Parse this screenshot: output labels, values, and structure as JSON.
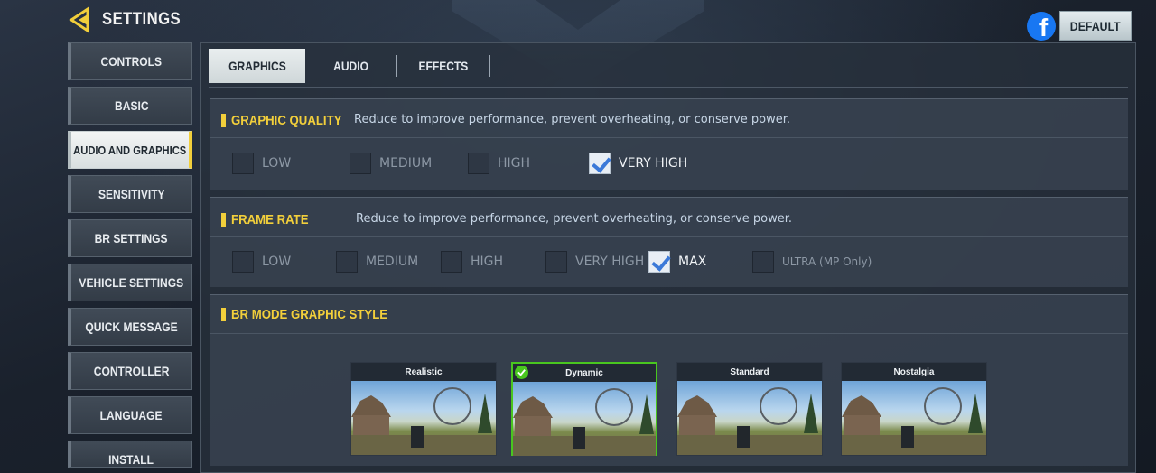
{
  "header": {
    "title": "SETTINGS",
    "default_label": "DEFAULT"
  },
  "sidebar": {
    "items": [
      {
        "label": "CONTROLS"
      },
      {
        "label": "BASIC"
      },
      {
        "label": "AUDIO AND GRAPHICS",
        "active": true
      },
      {
        "label": "SENSITIVITY"
      },
      {
        "label": "BR SETTINGS"
      },
      {
        "label": "VEHICLE SETTINGS"
      },
      {
        "label": "QUICK MESSAGE"
      },
      {
        "label": "CONTROLLER"
      },
      {
        "label": "LANGUAGE"
      },
      {
        "label": "INSTALL"
      }
    ]
  },
  "tabs": [
    {
      "label": "GRAPHICS",
      "active": true
    },
    {
      "label": "AUDIO"
    },
    {
      "label": "EFFECTS"
    }
  ],
  "graphic_quality": {
    "title": "GRAPHIC QUALITY",
    "description": "Reduce to improve performance, prevent overheating, or conserve power.",
    "options": [
      "LOW",
      "MEDIUM",
      "HIGH",
      "VERY HIGH"
    ],
    "selected": "VERY HIGH"
  },
  "frame_rate": {
    "title": "FRAME RATE",
    "description": "Reduce to improve performance, prevent overheating, or conserve power.",
    "options": [
      "LOW",
      "MEDIUM",
      "HIGH",
      "VERY HIGH",
      "MAX",
      "ULTRA (MP Only)"
    ],
    "selected": "MAX"
  },
  "br_style": {
    "title": "BR MODE GRAPHIC STYLE",
    "styles": [
      "Realistic",
      "Dynamic",
      "Standard",
      "Nostalgia"
    ],
    "selected": "Dynamic"
  },
  "colors": {
    "accent_yellow": "#f2cf3b",
    "selected_green": "#49c61f",
    "check_blue": "#3b79d8",
    "facebook_blue": "#1877f2"
  },
  "icons": [
    "back-arrow-icon",
    "facebook-icon",
    "checkmark-icon"
  ]
}
